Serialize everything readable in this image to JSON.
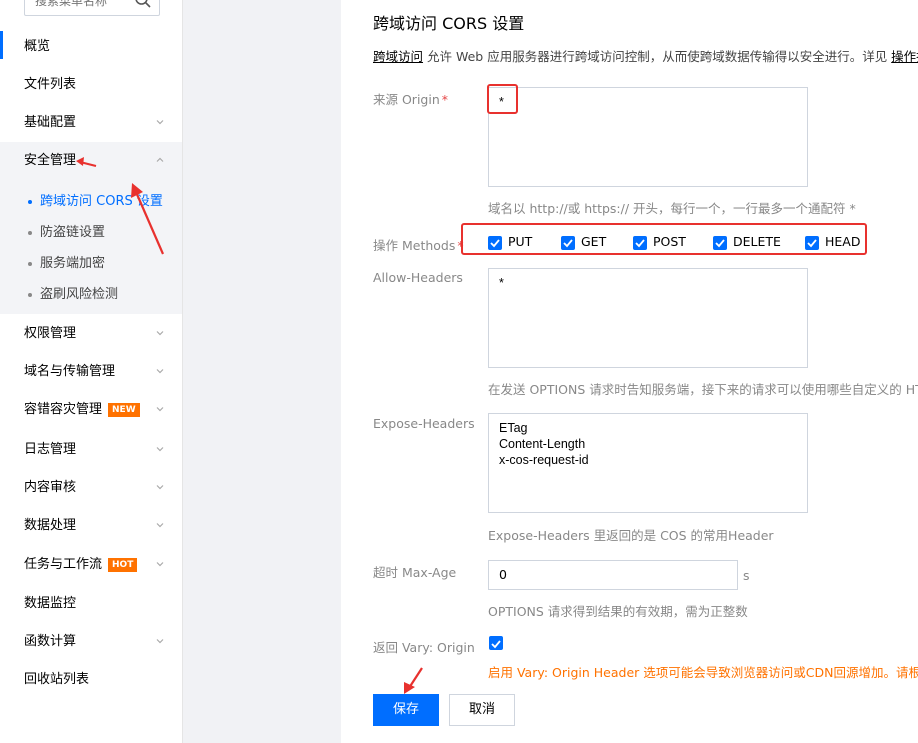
{
  "sidebar": {
    "search_placeholder": "搜索菜单名称",
    "items": [
      {
        "label": "概览"
      },
      {
        "label": "文件列表"
      },
      {
        "label": "基础配置"
      },
      {
        "label": "安全管理"
      },
      {
        "label": "权限管理"
      },
      {
        "label": "域名与传输管理"
      },
      {
        "label": "容错容灾管理",
        "badge": "NEW"
      },
      {
        "label": "日志管理"
      },
      {
        "label": "内容审核"
      },
      {
        "label": "数据处理"
      },
      {
        "label": "任务与工作流",
        "badge": "HOT"
      },
      {
        "label": "数据监控"
      },
      {
        "label": "函数计算"
      },
      {
        "label": "回收站列表"
      }
    ],
    "security_sub": [
      {
        "label": "跨域访问 CORS 设置"
      },
      {
        "label": "防盗链设置"
      },
      {
        "label": "服务端加密"
      },
      {
        "label": "盗刷风险检测"
      }
    ],
    "badge_colors": {
      "NEW": "#ff7200",
      "HOT": "#ff7200"
    }
  },
  "page": {
    "title": "跨域访问 CORS 设置",
    "desc_link": "跨域访问",
    "desc_text": " 允许 Web 应用服务器进行跨域访问控制，从而使跨域数据传输得以安全进行。详见 ",
    "desc_link2": "操作指南"
  },
  "form": {
    "origin_label": "来源 Origin",
    "required_mark": "*",
    "origin_value": "*",
    "origin_hint": "域名以 http://或 https:// 开头，每行一个，一行最多一个通配符 *",
    "methods_label": "操作 Methods",
    "methods": [
      {
        "label": "PUT",
        "checked": true
      },
      {
        "label": "GET",
        "checked": true
      },
      {
        "label": "POST",
        "checked": true
      },
      {
        "label": "DELETE",
        "checked": true
      },
      {
        "label": "HEAD",
        "checked": true
      }
    ],
    "allow_headers_label": "Allow-Headers",
    "allow_headers_value": "*",
    "allow_headers_hint": "在发送 OPTIONS 请求时告知服务端，接下来的请求可以使用哪些自定义的 HTTP",
    "expose_headers_label": "Expose-Headers",
    "expose_headers_value": "ETag\nContent-Length\nx-cos-request-id",
    "expose_headers_hint": "Expose-Headers 里返回的是 COS 的常用Header",
    "max_age_label": "超时 Max-Age",
    "max_age_value": "0",
    "max_age_unit": "s",
    "max_age_hint": "OPTIONS 请求得到结果的有效期，需为正整数",
    "vary_label": "返回 Vary: Origin",
    "vary_checked": true,
    "vary_warning": "启用 Vary: Origin Header 选项可能会导致浏览器访问或CDN回源增加。请根据"
  },
  "actions": {
    "save_label": "保存",
    "cancel_label": "取消"
  },
  "colors": {
    "accent": "#006eff",
    "annotation_red": "#e8312e",
    "warning": "#ff7200"
  }
}
